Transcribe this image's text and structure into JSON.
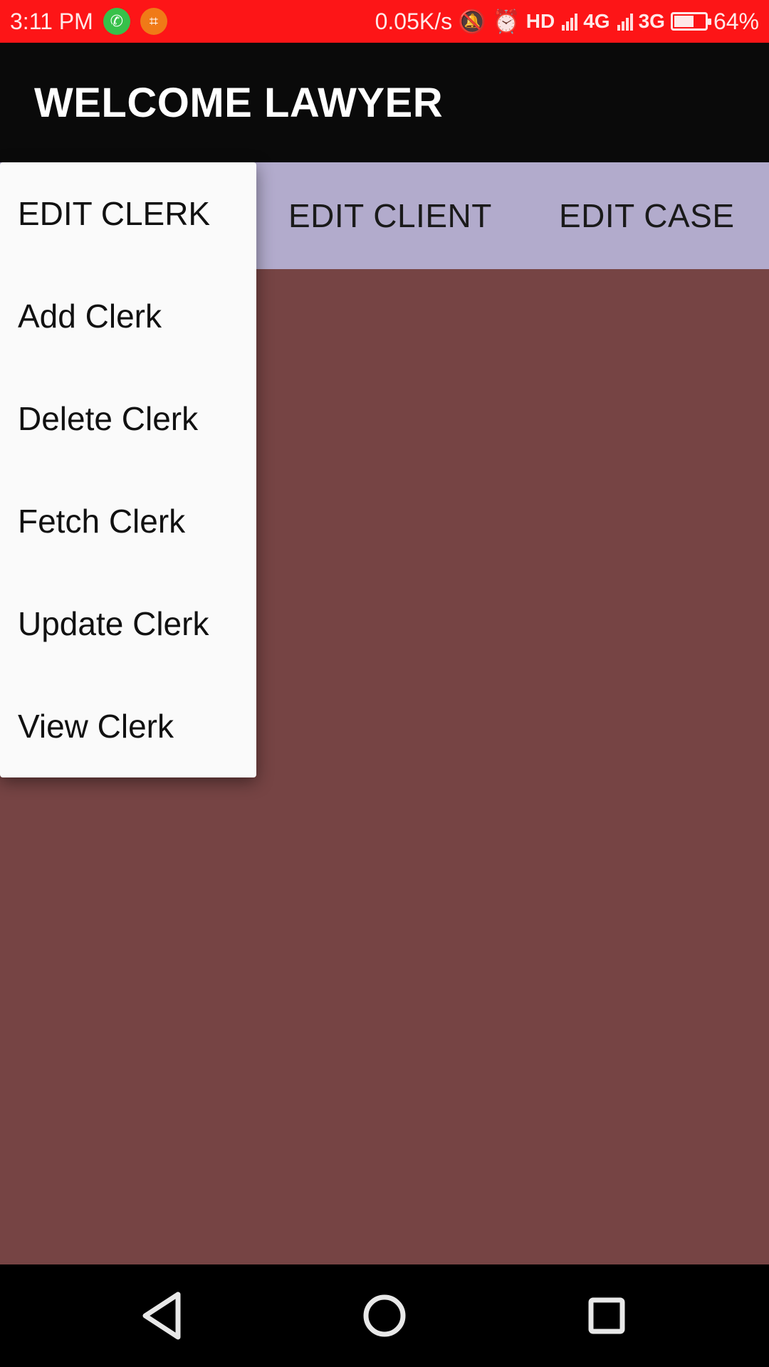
{
  "status_bar": {
    "time": "3:11 PM",
    "net_speed": "0.05K/s",
    "hd": "HD",
    "net1": "4G",
    "net2": "3G",
    "battery_text": "64%",
    "battery_level": 0.64,
    "icons": [
      "whatsapp-icon",
      "crop-icon",
      "mute-icon",
      "alarm-icon",
      "signal-icon",
      "battery-icon"
    ],
    "color": "#fd1517"
  },
  "app_bar": {
    "title": "WELCOME LAWYER",
    "color": "#0a0a0a"
  },
  "tabs": [
    {
      "label": "EDIT CLIENT"
    },
    {
      "label": "EDIT CASE"
    }
  ],
  "tab_strip_color": "#b2abcc",
  "popup_menu": {
    "items": [
      {
        "label": "EDIT CLERK"
      },
      {
        "label": "Add Clerk"
      },
      {
        "label": "Delete Clerk"
      },
      {
        "label": "Fetch Clerk"
      },
      {
        "label": "Update Clerk"
      },
      {
        "label": "View Clerk"
      }
    ]
  },
  "content_background": "#764444",
  "nav_bar": {
    "icons": [
      "back-icon",
      "home-icon",
      "recents-icon"
    ]
  }
}
